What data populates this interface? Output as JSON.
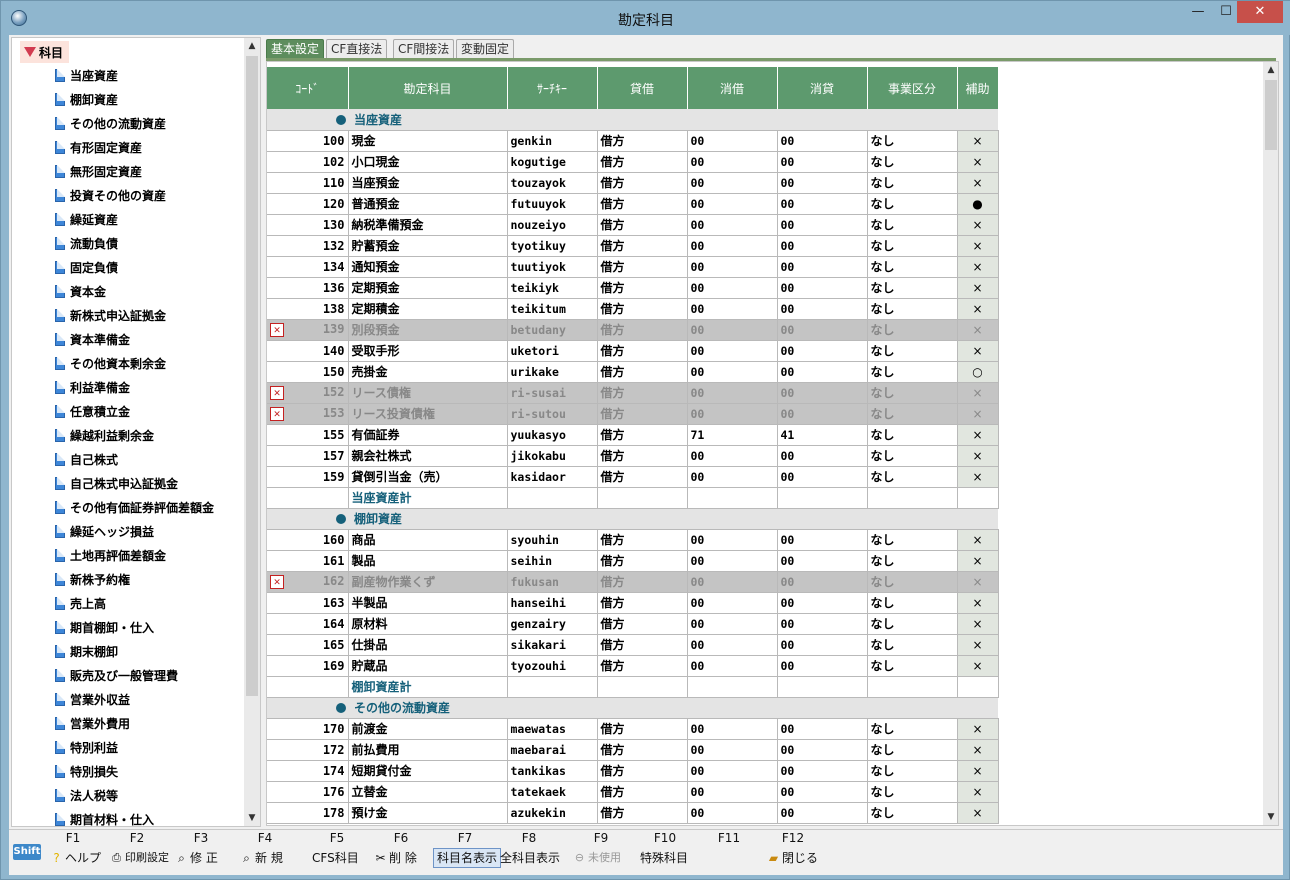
{
  "window": {
    "title": "勘定科目",
    "btn_min": "—",
    "btn_max": "☐",
    "btn_close": "✕"
  },
  "tree": {
    "root": "科目",
    "items": [
      "当座資産",
      "棚卸資産",
      "その他の流動資産",
      "有形固定資産",
      "無形固定資産",
      "投資その他の資産",
      "繰延資産",
      "流動負債",
      "固定負債",
      "資本金",
      "新株式申込証拠金",
      "資本準備金",
      "その他資本剰余金",
      "利益準備金",
      "任意積立金",
      "繰越利益剰余金",
      "自己株式",
      "自己株式申込証拠金",
      "その他有価証券評価差額金",
      "繰延ヘッジ損益",
      "土地再評価差額金",
      "新株予約権",
      "売上高",
      "期首棚卸・仕入",
      "期末棚卸",
      "販売及び一般管理費",
      "営業外収益",
      "営業外費用",
      "特別利益",
      "特別損失",
      "法人税等",
      "期首材料・仕入"
    ]
  },
  "tabs": [
    "基本設定",
    "CF直接法",
    "CF間接法",
    "変動固定"
  ],
  "columns": [
    "ｺｰﾄﾞ",
    "勘定科目",
    "ｻｰﾁｷｰ",
    "貸借",
    "消借",
    "消貸",
    "事業区分",
    "補助"
  ],
  "rows": [
    {
      "type": "section",
      "name": "当座資産"
    },
    {
      "code": "100",
      "name": "現金",
      "key": "genkin",
      "taishaku": "借方",
      "shoshaku": "00",
      "shotai": "00",
      "jigyo": "なし",
      "hojo": "×"
    },
    {
      "code": "102",
      "name": "小口現金",
      "key": "kogutige",
      "taishaku": "借方",
      "shoshaku": "00",
      "shotai": "00",
      "jigyo": "なし",
      "hojo": "×"
    },
    {
      "code": "110",
      "name": "当座預金",
      "key": "touzayok",
      "taishaku": "借方",
      "shoshaku": "00",
      "shotai": "00",
      "jigyo": "なし",
      "hojo": "×"
    },
    {
      "code": "120",
      "name": "普通預金",
      "key": "futuuyok",
      "taishaku": "借方",
      "shoshaku": "00",
      "shotai": "00",
      "jigyo": "なし",
      "hojo": "●"
    },
    {
      "code": "130",
      "name": "納税準備預金",
      "key": "nouzeiyo",
      "taishaku": "借方",
      "shoshaku": "00",
      "shotai": "00",
      "jigyo": "なし",
      "hojo": "×"
    },
    {
      "code": "132",
      "name": "貯蓄預金",
      "key": "tyotikuy",
      "taishaku": "借方",
      "shoshaku": "00",
      "shotai": "00",
      "jigyo": "なし",
      "hojo": "×"
    },
    {
      "code": "134",
      "name": "通知預金",
      "key": "tuutiyok",
      "taishaku": "借方",
      "shoshaku": "00",
      "shotai": "00",
      "jigyo": "なし",
      "hojo": "×"
    },
    {
      "code": "136",
      "name": "定期預金",
      "key": "teikiyk",
      "taishaku": "借方",
      "shoshaku": "00",
      "shotai": "00",
      "jigyo": "なし",
      "hojo": "×"
    },
    {
      "code": "138",
      "name": "定期積金",
      "key": "teikitum",
      "taishaku": "借方",
      "shoshaku": "00",
      "shotai": "00",
      "jigyo": "なし",
      "hojo": "×"
    },
    {
      "code": "139",
      "name": "別段預金",
      "key": "betudany",
      "taishaku": "借方",
      "shoshaku": "00",
      "shotai": "00",
      "jigyo": "なし",
      "hojo": "×",
      "disabled": true
    },
    {
      "code": "140",
      "name": "受取手形",
      "key": "uketori",
      "taishaku": "借方",
      "shoshaku": "00",
      "shotai": "00",
      "jigyo": "なし",
      "hojo": "×"
    },
    {
      "code": "150",
      "name": "売掛金",
      "key": "urikake",
      "taishaku": "借方",
      "shoshaku": "00",
      "shotai": "00",
      "jigyo": "なし",
      "hojo": "○"
    },
    {
      "code": "152",
      "name": "リース債権",
      "key": "ri-susai",
      "taishaku": "借方",
      "shoshaku": "00",
      "shotai": "00",
      "jigyo": "なし",
      "hojo": "×",
      "disabled": true
    },
    {
      "code": "153",
      "name": "リース投資債権",
      "key": "ri-sutou",
      "taishaku": "借方",
      "shoshaku": "00",
      "shotai": "00",
      "jigyo": "なし",
      "hojo": "×",
      "disabled": true
    },
    {
      "code": "155",
      "name": "有価証券",
      "key": "yuukasyo",
      "taishaku": "借方",
      "shoshaku": "71",
      "shotai": "41",
      "jigyo": "なし",
      "hojo": "×"
    },
    {
      "code": "157",
      "name": "親会社株式",
      "key": "jikokabu",
      "taishaku": "借方",
      "shoshaku": "00",
      "shotai": "00",
      "jigyo": "なし",
      "hojo": "×"
    },
    {
      "code": "159",
      "name": "貸倒引当金（売）",
      "key": "kasidaor",
      "taishaku": "借方",
      "shoshaku": "00",
      "shotai": "00",
      "jigyo": "なし",
      "hojo": "×"
    },
    {
      "type": "total",
      "name": "当座資産計"
    },
    {
      "type": "section",
      "name": "棚卸資産"
    },
    {
      "code": "160",
      "name": "商品",
      "key": "syouhin",
      "taishaku": "借方",
      "shoshaku": "00",
      "shotai": "00",
      "jigyo": "なし",
      "hojo": "×"
    },
    {
      "code": "161",
      "name": "製品",
      "key": "seihin",
      "taishaku": "借方",
      "shoshaku": "00",
      "shotai": "00",
      "jigyo": "なし",
      "hojo": "×"
    },
    {
      "code": "162",
      "name": "副産物作業くず",
      "key": "fukusan",
      "taishaku": "借方",
      "shoshaku": "00",
      "shotai": "00",
      "jigyo": "なし",
      "hojo": "×",
      "disabled": true
    },
    {
      "code": "163",
      "name": "半製品",
      "key": "hanseihi",
      "taishaku": "借方",
      "shoshaku": "00",
      "shotai": "00",
      "jigyo": "なし",
      "hojo": "×"
    },
    {
      "code": "164",
      "name": "原材料",
      "key": "genzairy",
      "taishaku": "借方",
      "shoshaku": "00",
      "shotai": "00",
      "jigyo": "なし",
      "hojo": "×"
    },
    {
      "code": "165",
      "name": "仕掛品",
      "key": "sikakari",
      "taishaku": "借方",
      "shoshaku": "00",
      "shotai": "00",
      "jigyo": "なし",
      "hojo": "×"
    },
    {
      "code": "169",
      "name": "貯蔵品",
      "key": "tyozouhi",
      "taishaku": "借方",
      "shoshaku": "00",
      "shotai": "00",
      "jigyo": "なし",
      "hojo": "×"
    },
    {
      "type": "total",
      "name": "棚卸資産計"
    },
    {
      "type": "section",
      "name": "その他の流動資産"
    },
    {
      "code": "170",
      "name": "前渡金",
      "key": "maewatas",
      "taishaku": "借方",
      "shoshaku": "00",
      "shotai": "00",
      "jigyo": "なし",
      "hojo": "×"
    },
    {
      "code": "172",
      "name": "前払費用",
      "key": "maebarai",
      "taishaku": "借方",
      "shoshaku": "00",
      "shotai": "00",
      "jigyo": "なし",
      "hojo": "×"
    },
    {
      "code": "174",
      "name": "短期貸付金",
      "key": "tankikas",
      "taishaku": "借方",
      "shoshaku": "00",
      "shotai": "00",
      "jigyo": "なし",
      "hojo": "×"
    },
    {
      "code": "176",
      "name": "立替金",
      "key": "tatekaek",
      "taishaku": "借方",
      "shoshaku": "00",
      "shotai": "00",
      "jigyo": "なし",
      "hojo": "×"
    },
    {
      "code": "178",
      "name": "預け金",
      "key": "azukekin",
      "taishaku": "借方",
      "shoshaku": "00",
      "shotai": "00",
      "jigyo": "なし",
      "hojo": "×"
    }
  ],
  "fkeys": [
    "F1",
    "F2",
    "F3",
    "F4",
    "F5",
    "F6",
    "F7",
    "F8",
    "F9",
    "F10",
    "F11",
    "F12"
  ],
  "fbar": {
    "shift": "Shift",
    "help": "ヘルプ",
    "print": "印刷設定",
    "edit": "修 正",
    "new": "新 規",
    "cfs": "CFS科目",
    "delete": "削 除",
    "name_display": "科目名表示",
    "all_display": "全科目表示",
    "unused": "未使用",
    "special": "特殊科目",
    "close": "閉じる"
  }
}
